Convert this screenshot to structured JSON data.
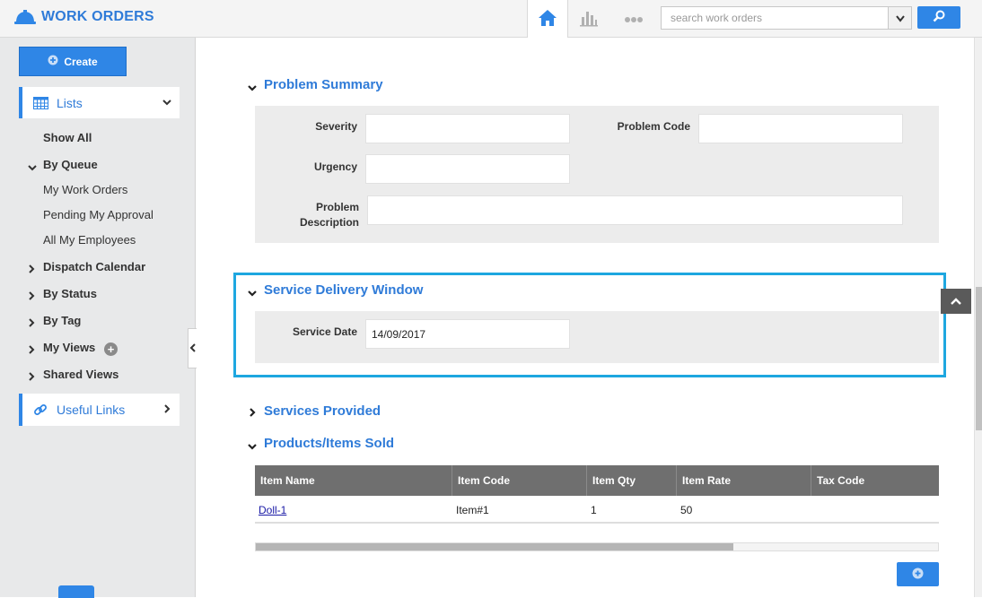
{
  "app": {
    "title": "WORK ORDERS"
  },
  "search": {
    "placeholder": "search work orders"
  },
  "sidebar": {
    "create_label": "Create",
    "lists": {
      "label": "Lists"
    },
    "items": {
      "show_all": "Show All",
      "by_queue": "By Queue",
      "my_work_orders": "My Work Orders",
      "pending_my_approval": "Pending My Approval",
      "all_my_employees": "All My Employees",
      "dispatch_calendar": "Dispatch Calendar",
      "by_status": "By Status",
      "by_tag": "By Tag",
      "my_views": "My Views",
      "shared_views": "Shared Views"
    },
    "my_views_add": "+",
    "useful_links": {
      "label": "Useful Links"
    }
  },
  "problem_summary": {
    "title": "Problem Summary",
    "severity_label": "Severity",
    "severity_value": "",
    "problem_code_label": "Problem Code",
    "problem_code_value": "",
    "urgency_label": "Urgency",
    "urgency_value": "",
    "problem_description_label_1": "Problem",
    "problem_description_label_2": "Description",
    "problem_description_value": ""
  },
  "service_delivery_window": {
    "title": "Service Delivery Window",
    "service_date_label": "Service Date",
    "service_date_value": "14/09/2017"
  },
  "services_provided": {
    "title": "Services Provided"
  },
  "products_items_sold": {
    "title": "Products/Items Sold",
    "columns": [
      "Item Name",
      "Item Code",
      "Item Qty",
      "Item Rate",
      "Tax Code"
    ],
    "rows": [
      {
        "item_name": "Doll-1",
        "item_code": "Item#1",
        "item_qty": "1",
        "item_rate": "50",
        "tax_code": ""
      }
    ]
  },
  "colors": {
    "accent": "#2f86e6",
    "title_blue": "#2f7bd8",
    "highlight": "#1ea7e0",
    "table_header": "#6f6f6f"
  },
  "icons": [
    "hard-hat-icon",
    "home-icon",
    "bar-chart-icon",
    "more-dots-icon",
    "chevron-down-icon",
    "search-icon",
    "plus-circle-icon",
    "calendar-grid-icon",
    "link-icon",
    "chevron-right-icon",
    "chevron-left-icon",
    "chevron-up-icon"
  ]
}
